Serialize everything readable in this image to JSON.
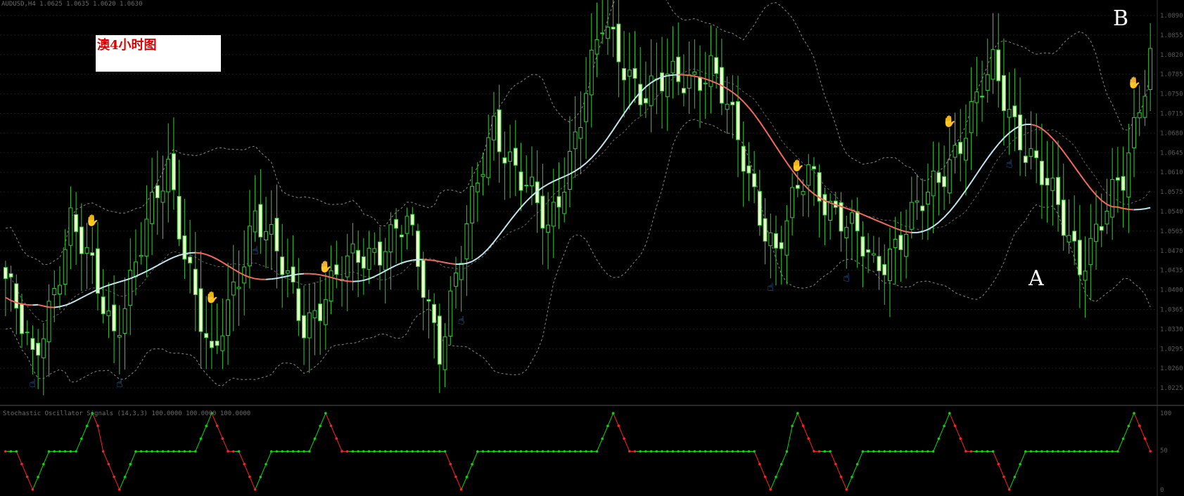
{
  "chart_data": {
    "type": "candlestick",
    "title": "澳4小时图",
    "header_text": "AUDUSD,H4  1.0625 1.0635 1.0620 1.0630",
    "indicator_header_text": "Stochastic Oscillator Signals (14,3,3) 100.0000 100.0000 100.0000",
    "annotations": {
      "point_a": "A",
      "point_b": "B"
    },
    "price_axis": {
      "range": [
        1.02,
        1.09
      ],
      "ticks": [
        "1.0890",
        "1.0855",
        "1.0820",
        "1.0785",
        "1.0750",
        "1.0715",
        "1.0680",
        "1.0645",
        "1.0610",
        "1.0575",
        "1.0540",
        "1.0505",
        "1.0470",
        "1.0435",
        "1.0400",
        "1.0365",
        "1.0330",
        "1.0295",
        "1.0260",
        "1.0225"
      ]
    },
    "indicator_axis": {
      "ticks": [
        "100",
        "50",
        "0"
      ]
    },
    "colors": {
      "background": "#000000",
      "candle": "#33cc33",
      "bull_body": "#000000",
      "bear_body": "#e8ffc8",
      "ma_up": "#bfe6f0",
      "ma_down": "#f46a5a",
      "bands": "#888888",
      "signal_top": "#ff3030",
      "signal_bottom": "#3a8ff0",
      "osc_up": "#00dd00",
      "osc_down": "#ff2020"
    },
    "signal_icons": {
      "top": "raised-hand-icon",
      "bottom": "pointing-hand-icon"
    },
    "pivot_sequence": [
      [
        0,
        1.042
      ],
      [
        5,
        1.0265
      ],
      [
        12,
        1.052
      ],
      [
        20,
        1.033
      ],
      [
        30,
        1.062
      ],
      [
        38,
        1.0255
      ],
      [
        46,
        1.0545
      ],
      [
        55,
        1.0345
      ],
      [
        65,
        1.046
      ],
      [
        74,
        1.051
      ],
      [
        80,
        1.0305
      ],
      [
        90,
        1.07
      ],
      [
        100,
        1.05
      ],
      [
        110,
        1.0865
      ],
      [
        118,
        1.075
      ],
      [
        130,
        1.08
      ],
      [
        142,
        1.0465
      ],
      [
        148,
        1.0615
      ],
      [
        160,
        1.044
      ],
      [
        170,
        1.056
      ],
      [
        182,
        1.079
      ],
      [
        188,
        1.066
      ],
      [
        198,
        1.0455
      ],
      [
        206,
        1.059
      ],
      [
        211,
        1.0835
      ]
    ],
    "top_signal_bars": [
      16,
      38,
      59,
      112,
      146,
      174,
      208
    ],
    "bottom_signal_bars": [
      5,
      21,
      46,
      84,
      141,
      155,
      185
    ]
  }
}
